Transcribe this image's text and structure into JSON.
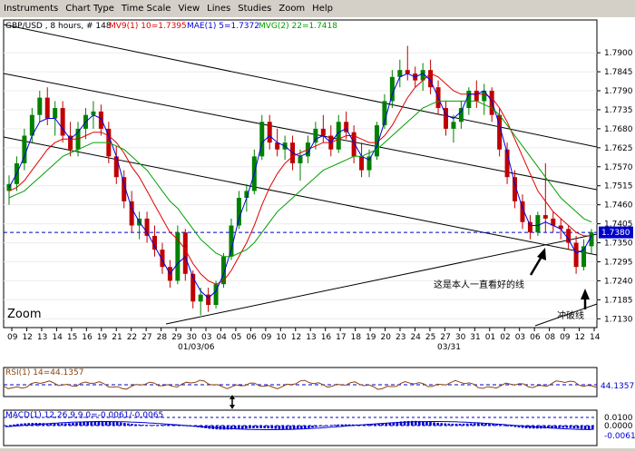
{
  "menu": [
    "Instruments",
    "Chart Type",
    "Time Scale",
    "View",
    "Lines",
    "Studies",
    "Zoom",
    "Help"
  ],
  "header": {
    "symbol": "GBP/USD , 8 hours, # 148",
    "mv9": "MV9(1) 10=1.7395",
    "mae": "MAE(1) 5=1.7372",
    "mvg": "MVG(2) 22=1.7418"
  },
  "colors": {
    "up": "#008000",
    "down": "#c00000",
    "mv9": "#e00000",
    "mae": "#0000e0",
    "mvg": "#00a000",
    "rsi": "#8b4513",
    "macd": "#0000cc"
  },
  "price_axis": [
    "1.7900",
    "1.7845",
    "1.7790",
    "1.7735",
    "1.7680",
    "1.7625",
    "1.7570",
    "1.7515",
    "1.7460",
    "1.7405",
    "1.7350",
    "1.7295",
    "1.7240",
    "1.7185",
    "1.7130"
  ],
  "current_price": "1.7380",
  "zoom_label": "Zoom",
  "date_labels": [
    "09",
    "12",
    "13",
    "14",
    "15",
    "16",
    "19",
    "21",
    "22",
    "27",
    "28",
    "29",
    "30",
    "03",
    "04",
    "05",
    "06",
    "09",
    "10",
    "12",
    "13",
    "16",
    "17",
    "18",
    "19",
    "20",
    "23",
    "24",
    "25",
    "27",
    "30",
    "31",
    "01",
    "02",
    "03",
    "06",
    "08",
    "09",
    "12",
    "14"
  ],
  "date_labels_row2": [
    "01/03/06",
    "03/31"
  ],
  "annotations": {
    "line": "这是本人一直看好的线",
    "break": "冲破线"
  },
  "rsi": {
    "label": "RSI(1) 14=44.1357",
    "value": "44.1357"
  },
  "macd": {
    "label": "MACD(1) 12,26,9,9,0=-0.0061/-0.0065",
    "levels": [
      "0.0100",
      "0.0000"
    ],
    "value": "-0.0061"
  },
  "chart_data": {
    "type": "candlestick",
    "ylim": [
      1.7115,
      1.7945
    ],
    "current_price": 1.738,
    "candles": [
      [
        1.75,
        1.7545,
        1.746,
        1.752
      ],
      [
        1.752,
        1.76,
        1.75,
        1.758
      ],
      [
        1.758,
        1.768,
        1.756,
        1.766
      ],
      [
        1.766,
        1.774,
        1.764,
        1.772
      ],
      [
        1.772,
        1.779,
        1.77,
        1.777
      ],
      [
        1.777,
        1.78,
        1.769,
        1.771
      ],
      [
        1.771,
        1.776,
        1.766,
        1.774
      ],
      [
        1.774,
        1.776,
        1.764,
        1.766
      ],
      [
        1.766,
        1.77,
        1.76,
        1.762
      ],
      [
        1.762,
        1.77,
        1.76,
        1.768
      ],
      [
        1.768,
        1.774,
        1.765,
        1.772
      ],
      [
        1.772,
        1.776,
        1.768,
        1.773
      ],
      [
        1.773,
        1.775,
        1.766,
        1.768
      ],
      [
        1.768,
        1.77,
        1.758,
        1.76
      ],
      [
        1.76,
        1.763,
        1.752,
        1.754
      ],
      [
        1.754,
        1.756,
        1.745,
        1.747
      ],
      [
        1.747,
        1.75,
        1.738,
        1.74
      ],
      [
        1.74,
        1.744,
        1.736,
        1.742
      ],
      [
        1.742,
        1.744,
        1.735,
        1.737
      ],
      [
        1.737,
        1.74,
        1.731,
        1.733
      ],
      [
        1.733,
        1.735,
        1.726,
        1.728
      ],
      [
        1.728,
        1.73,
        1.722,
        1.724
      ],
      [
        1.724,
        1.74,
        1.723,
        1.738
      ],
      [
        1.738,
        1.739,
        1.724,
        1.726
      ],
      [
        1.726,
        1.727,
        1.716,
        1.718
      ],
      [
        1.718,
        1.722,
        1.714,
        1.72
      ],
      [
        1.72,
        1.722,
        1.715,
        1.717
      ],
      [
        1.717,
        1.724,
        1.716,
        1.723
      ],
      [
        1.723,
        1.732,
        1.722,
        1.731
      ],
      [
        1.731,
        1.742,
        1.73,
        1.74
      ],
      [
        1.74,
        1.75,
        1.739,
        1.748
      ],
      [
        1.748,
        1.752,
        1.744,
        1.75
      ],
      [
        1.75,
        1.762,
        1.749,
        1.76
      ],
      [
        1.76,
        1.772,
        1.759,
        1.77
      ],
      [
        1.77,
        1.772,
        1.762,
        1.764
      ],
      [
        1.764,
        1.768,
        1.76,
        1.762
      ],
      [
        1.762,
        1.766,
        1.759,
        1.764
      ],
      [
        1.764,
        1.766,
        1.756,
        1.758
      ],
      [
        1.758,
        1.762,
        1.753,
        1.76
      ],
      [
        1.76,
        1.766,
        1.758,
        1.764
      ],
      [
        1.764,
        1.77,
        1.762,
        1.768
      ],
      [
        1.768,
        1.772,
        1.764,
        1.766
      ],
      [
        1.766,
        1.769,
        1.76,
        1.762
      ],
      [
        1.762,
        1.772,
        1.761,
        1.77
      ],
      [
        1.77,
        1.773,
        1.765,
        1.767
      ],
      [
        1.767,
        1.769,
        1.758,
        1.76
      ],
      [
        1.76,
        1.764,
        1.754,
        1.756
      ],
      [
        1.756,
        1.762,
        1.754,
        1.76
      ],
      [
        1.76,
        1.77,
        1.759,
        1.769
      ],
      [
        1.769,
        1.778,
        1.768,
        1.776
      ],
      [
        1.776,
        1.785,
        1.774,
        1.783
      ],
      [
        1.783,
        1.788,
        1.78,
        1.785
      ],
      [
        1.785,
        1.792,
        1.782,
        1.784
      ],
      [
        1.784,
        1.786,
        1.78,
        1.782
      ],
      [
        1.782,
        1.787,
        1.779,
        1.785
      ],
      [
        1.785,
        1.788,
        1.778,
        1.78
      ],
      [
        1.78,
        1.782,
        1.772,
        1.774
      ],
      [
        1.774,
        1.776,
        1.766,
        1.768
      ],
      [
        1.768,
        1.772,
        1.764,
        1.77
      ],
      [
        1.77,
        1.776,
        1.768,
        1.774
      ],
      [
        1.774,
        1.78,
        1.772,
        1.779
      ],
      [
        1.779,
        1.782,
        1.774,
        1.776
      ],
      [
        1.776,
        1.781,
        1.772,
        1.779
      ],
      [
        1.779,
        1.78,
        1.77,
        1.772
      ],
      [
        1.772,
        1.774,
        1.76,
        1.762
      ],
      [
        1.762,
        1.764,
        1.752,
        1.754
      ],
      [
        1.754,
        1.756,
        1.745,
        1.747
      ],
      [
        1.747,
        1.749,
        1.739,
        1.741
      ],
      [
        1.741,
        1.743,
        1.736,
        1.738
      ],
      [
        1.738,
        1.744,
        1.737,
        1.743
      ],
      [
        1.743,
        1.758,
        1.738,
        1.742
      ],
      [
        1.742,
        1.744,
        1.738,
        1.74
      ],
      [
        1.74,
        1.742,
        1.736,
        1.739
      ],
      [
        1.739,
        1.74,
        1.733,
        1.735
      ],
      [
        1.735,
        1.737,
        1.726,
        1.728
      ],
      [
        1.728,
        1.736,
        1.727,
        1.734
      ],
      [
        1.734,
        1.739,
        1.732,
        1.738
      ]
    ],
    "mv9": [
      1.75,
      1.751,
      1.753,
      1.756,
      1.759,
      1.762,
      1.764,
      1.765,
      1.765,
      1.765,
      1.766,
      1.767,
      1.767,
      1.766,
      1.764,
      1.761,
      1.757,
      1.754,
      1.75,
      1.746,
      1.742,
      1.738,
      1.736,
      1.733,
      1.729,
      1.726,
      1.724,
      1.723,
      1.724,
      1.727,
      1.731,
      1.735,
      1.74,
      1.746,
      1.751,
      1.755,
      1.758,
      1.76,
      1.761,
      1.762,
      1.763,
      1.764,
      1.764,
      1.765,
      1.766,
      1.766,
      1.765,
      1.764,
      1.764,
      1.766,
      1.769,
      1.773,
      1.777,
      1.78,
      1.782,
      1.784,
      1.783,
      1.781,
      1.779,
      1.778,
      1.778,
      1.778,
      1.778,
      1.777,
      1.774,
      1.77,
      1.765,
      1.76,
      1.755,
      1.75,
      1.747,
      1.744,
      1.742,
      1.74,
      1.738,
      1.737,
      1.737
    ],
    "mae": [
      1.751,
      1.755,
      1.76,
      1.766,
      1.77,
      1.771,
      1.771,
      1.768,
      1.765,
      1.767,
      1.77,
      1.772,
      1.771,
      1.766,
      1.76,
      1.752,
      1.745,
      1.741,
      1.738,
      1.734,
      1.73,
      1.726,
      1.729,
      1.731,
      1.725,
      1.721,
      1.719,
      1.721,
      1.726,
      1.733,
      1.742,
      1.748,
      1.755,
      1.764,
      1.766,
      1.764,
      1.763,
      1.761,
      1.76,
      1.761,
      1.765,
      1.766,
      1.764,
      1.767,
      1.768,
      1.764,
      1.76,
      1.759,
      1.763,
      1.77,
      1.778,
      1.783,
      1.784,
      1.783,
      1.784,
      1.782,
      1.777,
      1.772,
      1.771,
      1.773,
      1.778,
      1.778,
      1.779,
      1.776,
      1.769,
      1.761,
      1.752,
      1.745,
      1.74,
      1.74,
      1.741,
      1.74,
      1.739,
      1.736,
      1.732,
      1.733,
      1.737
    ],
    "mvg": [
      1.748,
      1.749,
      1.75,
      1.752,
      1.754,
      1.756,
      1.758,
      1.76,
      1.761,
      1.762,
      1.763,
      1.764,
      1.764,
      1.764,
      1.763,
      1.762,
      1.76,
      1.758,
      1.756,
      1.753,
      1.75,
      1.747,
      1.745,
      1.742,
      1.739,
      1.736,
      1.734,
      1.732,
      1.731,
      1.731,
      1.732,
      1.733,
      1.735,
      1.738,
      1.741,
      1.744,
      1.746,
      1.748,
      1.75,
      1.752,
      1.754,
      1.756,
      1.757,
      1.758,
      1.759,
      1.76,
      1.76,
      1.761,
      1.762,
      1.764,
      1.766,
      1.768,
      1.77,
      1.772,
      1.774,
      1.775,
      1.776,
      1.776,
      1.776,
      1.776,
      1.776,
      1.776,
      1.775,
      1.774,
      1.772,
      1.769,
      1.766,
      1.763,
      1.76,
      1.757,
      1.754,
      1.751,
      1.748,
      1.746,
      1.744,
      1.742,
      1.741
    ]
  }
}
